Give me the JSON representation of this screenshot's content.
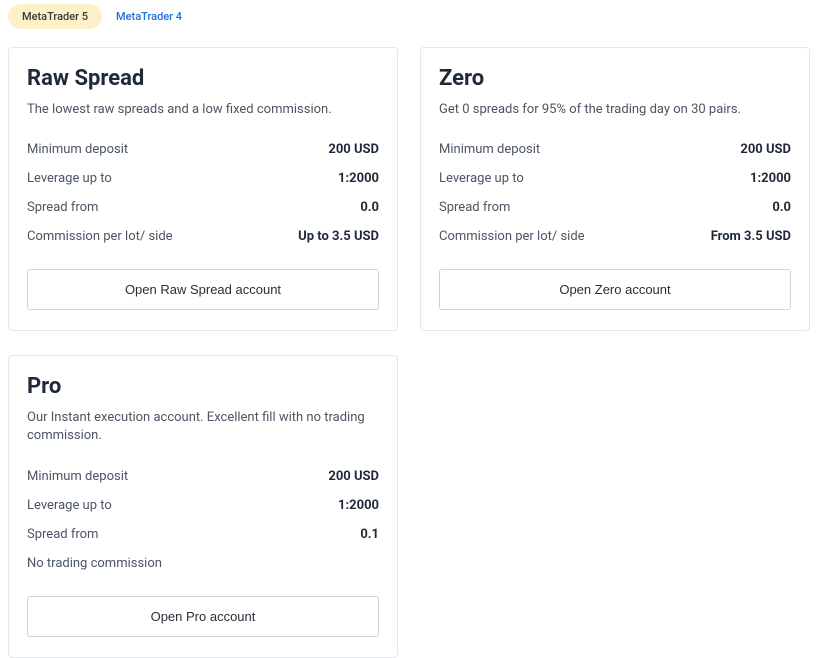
{
  "tabs": [
    {
      "label": "MetaTrader 5",
      "active": true
    },
    {
      "label": "MetaTrader 4",
      "active": false
    }
  ],
  "cards": {
    "raw_spread": {
      "title": "Raw Spread",
      "description": "The lowest raw spreads and a low fixed commission.",
      "specs": [
        {
          "label": "Minimum deposit",
          "value": "200 USD"
        },
        {
          "label": "Leverage up to",
          "value": "1:2000"
        },
        {
          "label": "Spread from",
          "value": "0.0"
        },
        {
          "label": "Commission per lot/ side",
          "value": "Up to 3.5 USD"
        }
      ],
      "button": "Open Raw Spread account"
    },
    "zero": {
      "title": "Zero",
      "description": "Get 0 spreads for 95% of the trading day on 30 pairs.",
      "specs": [
        {
          "label": "Minimum deposit",
          "value": "200 USD"
        },
        {
          "label": "Leverage up to",
          "value": "1:2000"
        },
        {
          "label": "Spread from",
          "value": "0.0"
        },
        {
          "label": "Commission per lot/ side",
          "value": "From 3.5 USD"
        }
      ],
      "button": "Open Zero account"
    },
    "pro": {
      "title": "Pro",
      "description": "Our Instant execution account. Excellent fill with no trading commission.",
      "specs": [
        {
          "label": "Minimum deposit",
          "value": "200 USD"
        },
        {
          "label": "Leverage up to",
          "value": "1:2000"
        },
        {
          "label": "Spread from",
          "value": "0.1"
        }
      ],
      "note": "No trading commission",
      "button": "Open Pro account"
    }
  }
}
